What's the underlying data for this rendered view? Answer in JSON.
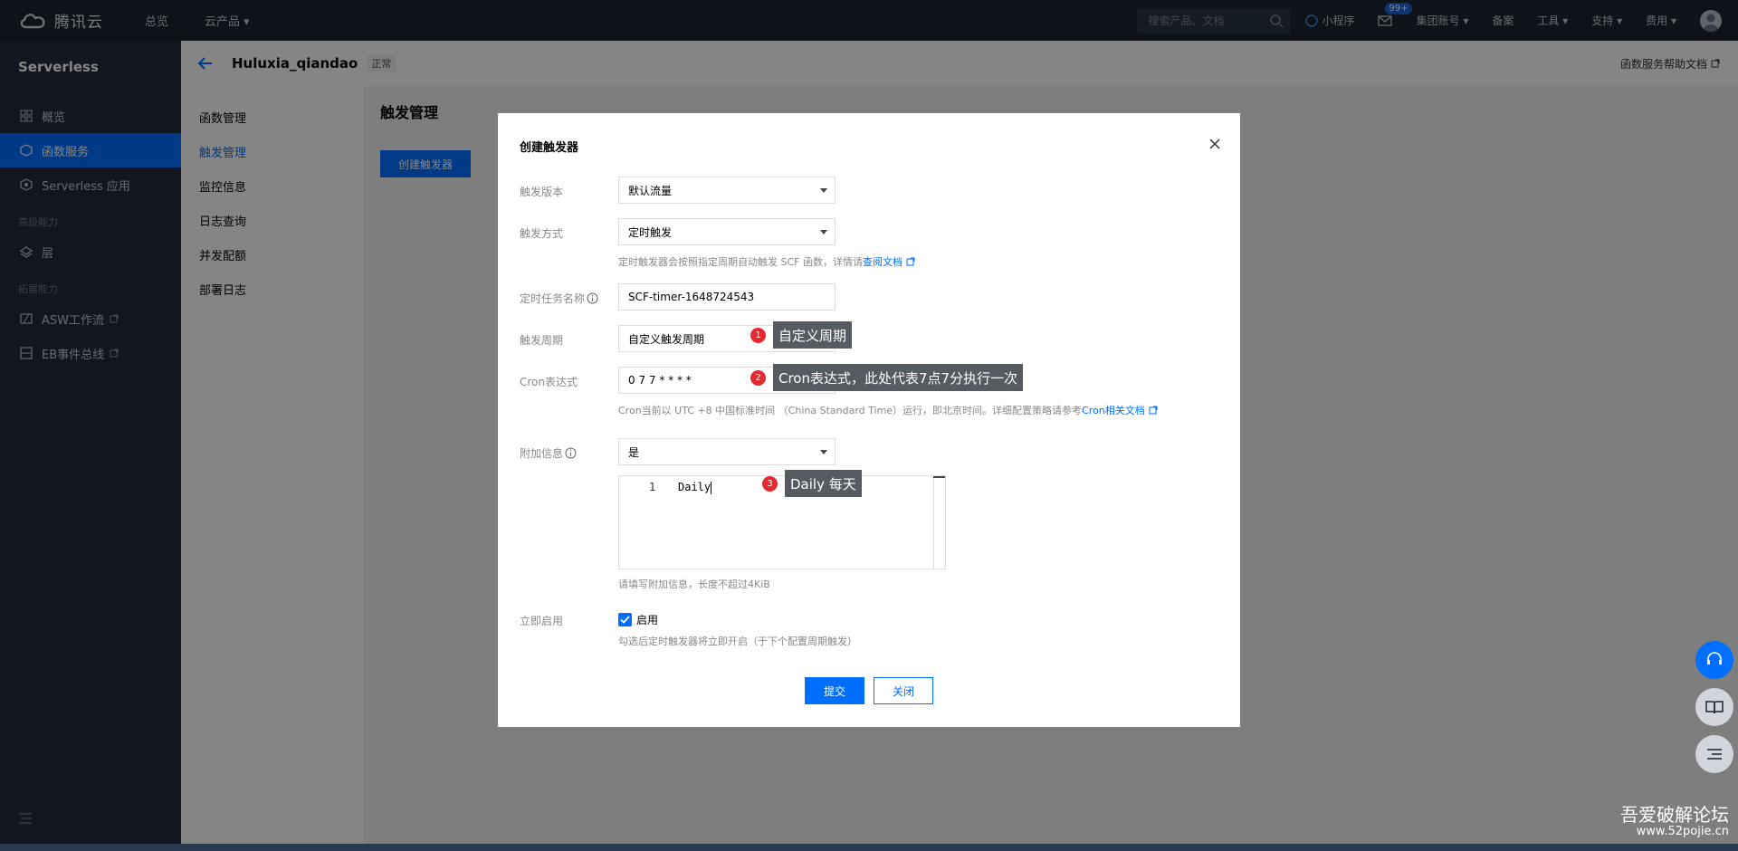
{
  "topbar": {
    "logo_text": "腾讯云",
    "nav": [
      "总览",
      "云产品"
    ],
    "search_placeholder": "搜索产品、文档",
    "mini_program": "小程序",
    "mail_badge": "99+",
    "group_account": "集团账号",
    "filing": "备案",
    "tools": "工具",
    "support": "支持",
    "billing": "费用"
  },
  "sidebar": {
    "title": "Serverless",
    "items": [
      {
        "label": "概览",
        "icon": "grid-icon"
      },
      {
        "label": "函数服务",
        "icon": "function-icon",
        "active": true
      },
      {
        "label": "Serverless 应用",
        "icon": "app-icon"
      }
    ],
    "group_advanced": "高级能力",
    "layer": "层",
    "group_extend": "拓展能力",
    "asw": "ASW工作流",
    "eb": "EB事件总线"
  },
  "header": {
    "function_name": "Huluxia_qiandao",
    "status": "正常",
    "help_link": "函数服务帮助文档"
  },
  "submenu": [
    "函数管理",
    "触发管理",
    "监控信息",
    "日志查询",
    "并发配额",
    "部署日志"
  ],
  "main": {
    "title": "触发管理",
    "create_button": "创建触发器"
  },
  "modal": {
    "title": "创建触发器",
    "version_label": "触发版本",
    "version_value": "默认流量",
    "method_label": "触发方式",
    "method_value": "定时触发",
    "method_hint": "定时触发器会按照指定周期自动触发 SCF 函数，详情请",
    "method_hint_link": "查阅文档",
    "task_name_label": "定时任务名称",
    "task_name_value": "SCF-timer-1648724543",
    "period_label": "触发周期",
    "period_value": "自定义触发周期",
    "cron_label": "Cron表达式",
    "cron_value": "0 7 7 * * * *",
    "cron_hint": "Cron当前以 UTC +8 中国标准时间 （China Standard Time）运行，即北京时间。详细配置策略请参考",
    "cron_hint_link": "Cron相关文档",
    "extra_label": "附加信息",
    "extra_value": "是",
    "editor_line": "1",
    "editor_code": "Daily",
    "extra_hint": "请填写附加信息，长度不超过4KiB",
    "enable_label": "立即启用",
    "enable_check": "启用",
    "enable_hint": "勾选后定时触发器将立即开启（于下个配置周期触发）",
    "submit": "提交",
    "close": "关闭"
  },
  "annotations": [
    {
      "num": "1",
      "text": "自定义周期"
    },
    {
      "num": "2",
      "text": "Cron表达式，此处代表7点7分执行一次"
    },
    {
      "num": "3",
      "text": "Daily 每天"
    }
  ],
  "watermark": {
    "line1": "吾爱破解论坛",
    "line2": "www.52pojie.cn"
  },
  "colors": {
    "accent": "#006eff",
    "topbar": "#1b2431",
    "sidebar": "#232d3c",
    "annotation_badge": "#e5292f",
    "annotation_box": "#555b61"
  }
}
